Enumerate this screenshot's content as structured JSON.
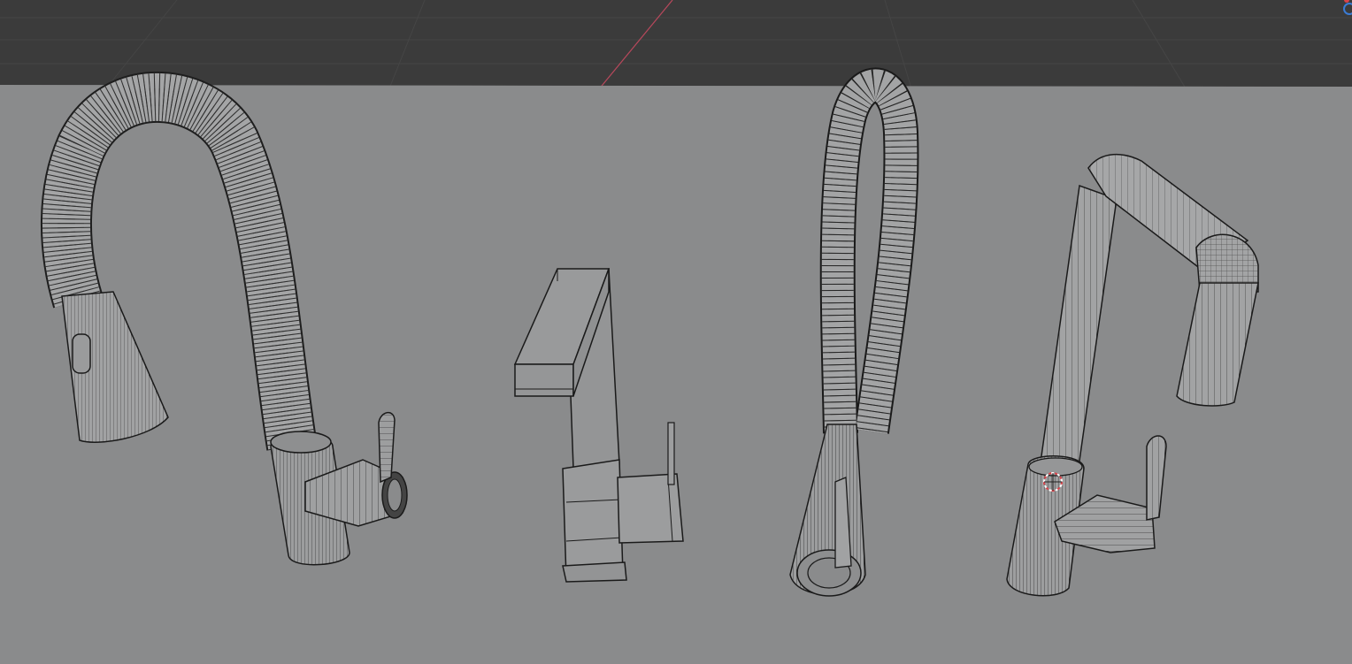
{
  "viewport": {
    "mode": "3d-viewport-wireframe",
    "world_background_color": "#3b3b3b",
    "grid_line_color": "#464646",
    "floor_plane_color": "#8a8b8c",
    "wire_color": "#1a1a1a",
    "x_axis_color": "#b8485c",
    "cursor_colors": [
      "#d9434a",
      "#ffffff"
    ],
    "gizmo_color": "#3a7bd5"
  },
  "objects": [
    {
      "name": "faucet-gooseneck-pull-down",
      "icon": "mesh-icon"
    },
    {
      "name": "faucet-square-block",
      "icon": "mesh-icon"
    },
    {
      "name": "faucet-flexible-hose",
      "icon": "mesh-icon"
    },
    {
      "name": "faucet-angled-square-spout",
      "icon": "mesh-icon"
    }
  ]
}
